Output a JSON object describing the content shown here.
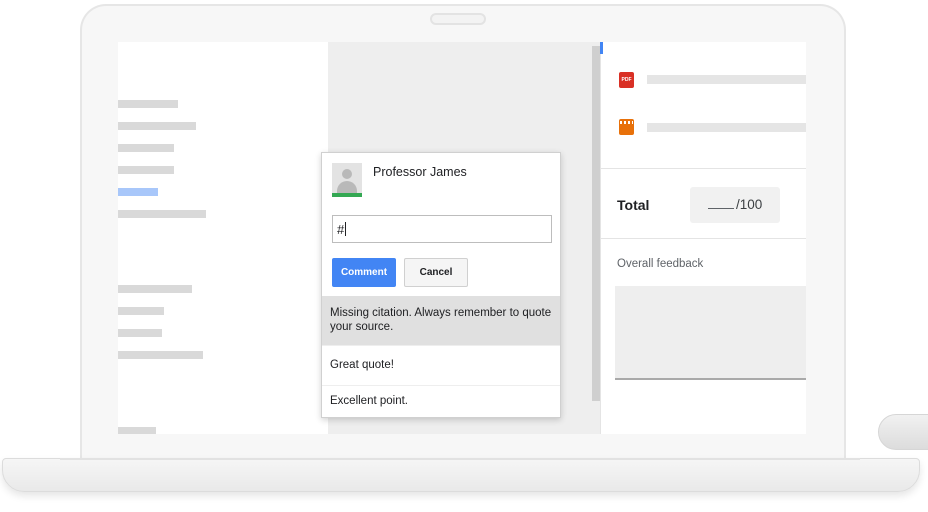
{
  "comment_box": {
    "author": "Professor James",
    "input_value": "#",
    "comment_button": "Comment",
    "cancel_button": "Cancel",
    "suggestions": [
      {
        "text": "Missing citation. Always remember to quote your source.",
        "highlighted": true
      },
      {
        "text": "Great quote!",
        "highlighted": false
      },
      {
        "text": "Excellent point.",
        "highlighted": false
      }
    ]
  },
  "attachments": [
    {
      "icon": "pdf-icon",
      "label": "PDF"
    },
    {
      "icon": "film-icon",
      "label": ""
    }
  ],
  "grading": {
    "total_label": "Total",
    "max_points": "/100",
    "feedback_label": "Overall feedback"
  },
  "colors": {
    "accent": "#4285f4",
    "avatar_underline": "#34a853",
    "pdf_icon": "#d93025",
    "film_icon": "#e8710a"
  }
}
